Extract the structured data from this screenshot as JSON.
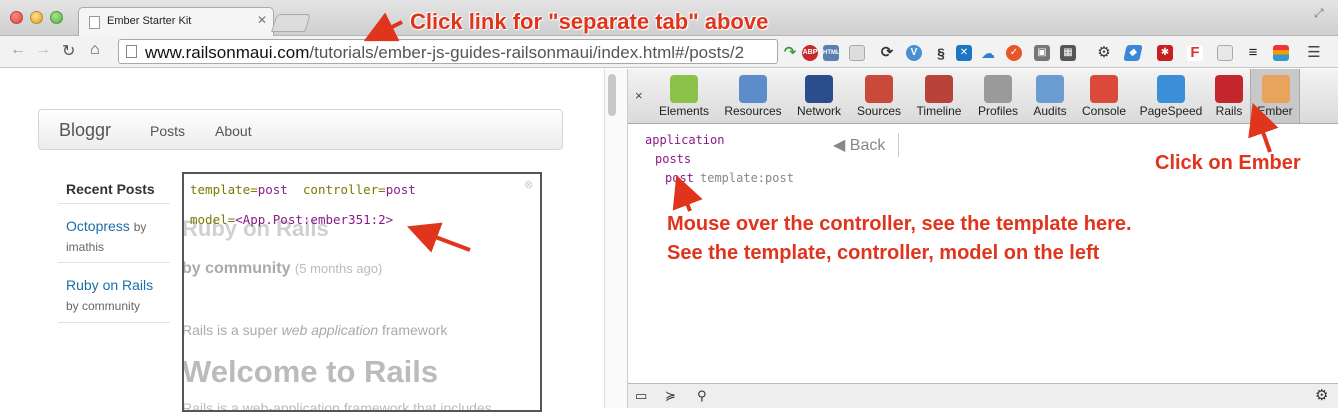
{
  "browser": {
    "tab_title": "Ember Starter Kit",
    "url_host": "www.railsonmaui.com",
    "url_path": "/tutorials/ember-js-guides-railsonmaui/index.html#/posts/2",
    "extension_abp_label": "ABP",
    "extension_html_label": "HTML",
    "extension_f_label": "F"
  },
  "page": {
    "brand": "Bloggr",
    "nav": [
      "Posts",
      "About"
    ],
    "sidebar": {
      "title": "Recent Posts",
      "posts": [
        {
          "title": "Octopress",
          "by": "by",
          "author": "imathis"
        },
        {
          "title": "Ruby on Rails",
          "author": "by community"
        }
      ]
    },
    "overlay": {
      "template_key": "template=",
      "template_val": "post",
      "controller_key": "controller=",
      "controller_val": "post",
      "model_key": "model=",
      "model_val": "<App.Post:ember351:2>"
    },
    "post": {
      "heading": "Ruby on Rails",
      "by_line": "by community",
      "age": "(5 months ago)",
      "intro_pre": "Rails is a super ",
      "intro_em": "web application",
      "intro_post": " framework",
      "welcome": "Welcome to Rails",
      "body": "Rails is a web-application framework that includes"
    }
  },
  "devtools": {
    "close": "×",
    "tabs": [
      {
        "label": "Elements",
        "color": "#8bc34a"
      },
      {
        "label": "Resources",
        "color": "#5d8ccb"
      },
      {
        "label": "Network",
        "color": "#2b4d8c"
      },
      {
        "label": "Sources",
        "color": "#c94a3a"
      },
      {
        "label": "Timeline",
        "color": "#b8433a"
      },
      {
        "label": "Profiles",
        "color": "#9a9a9a"
      },
      {
        "label": "Audits",
        "color": "#6a9bd1"
      },
      {
        "label": "Console",
        "color": "#d94a3a"
      },
      {
        "label": "PageSpeed",
        "color": "#3b8fd6"
      },
      {
        "label": "Rails",
        "color": "#c4262e"
      },
      {
        "label": "Ember",
        "color": "#e8a45c"
      }
    ],
    "tree": {
      "application": "application",
      "posts": "posts",
      "post": "post",
      "post_template": "template:post"
    },
    "back_label": "Back"
  },
  "annotations": {
    "separate_tab": "Click link for \"separate tab\" above",
    "click_ember": "Click on Ember",
    "mouse_over_1": "Mouse over the controller, see the template here.",
    "mouse_over_2": "See the template, controller, model on the left"
  },
  "colors": {
    "annotation": "#e0341c",
    "link": "#1a6ea8",
    "tree_purple": "#8a1a8a"
  }
}
